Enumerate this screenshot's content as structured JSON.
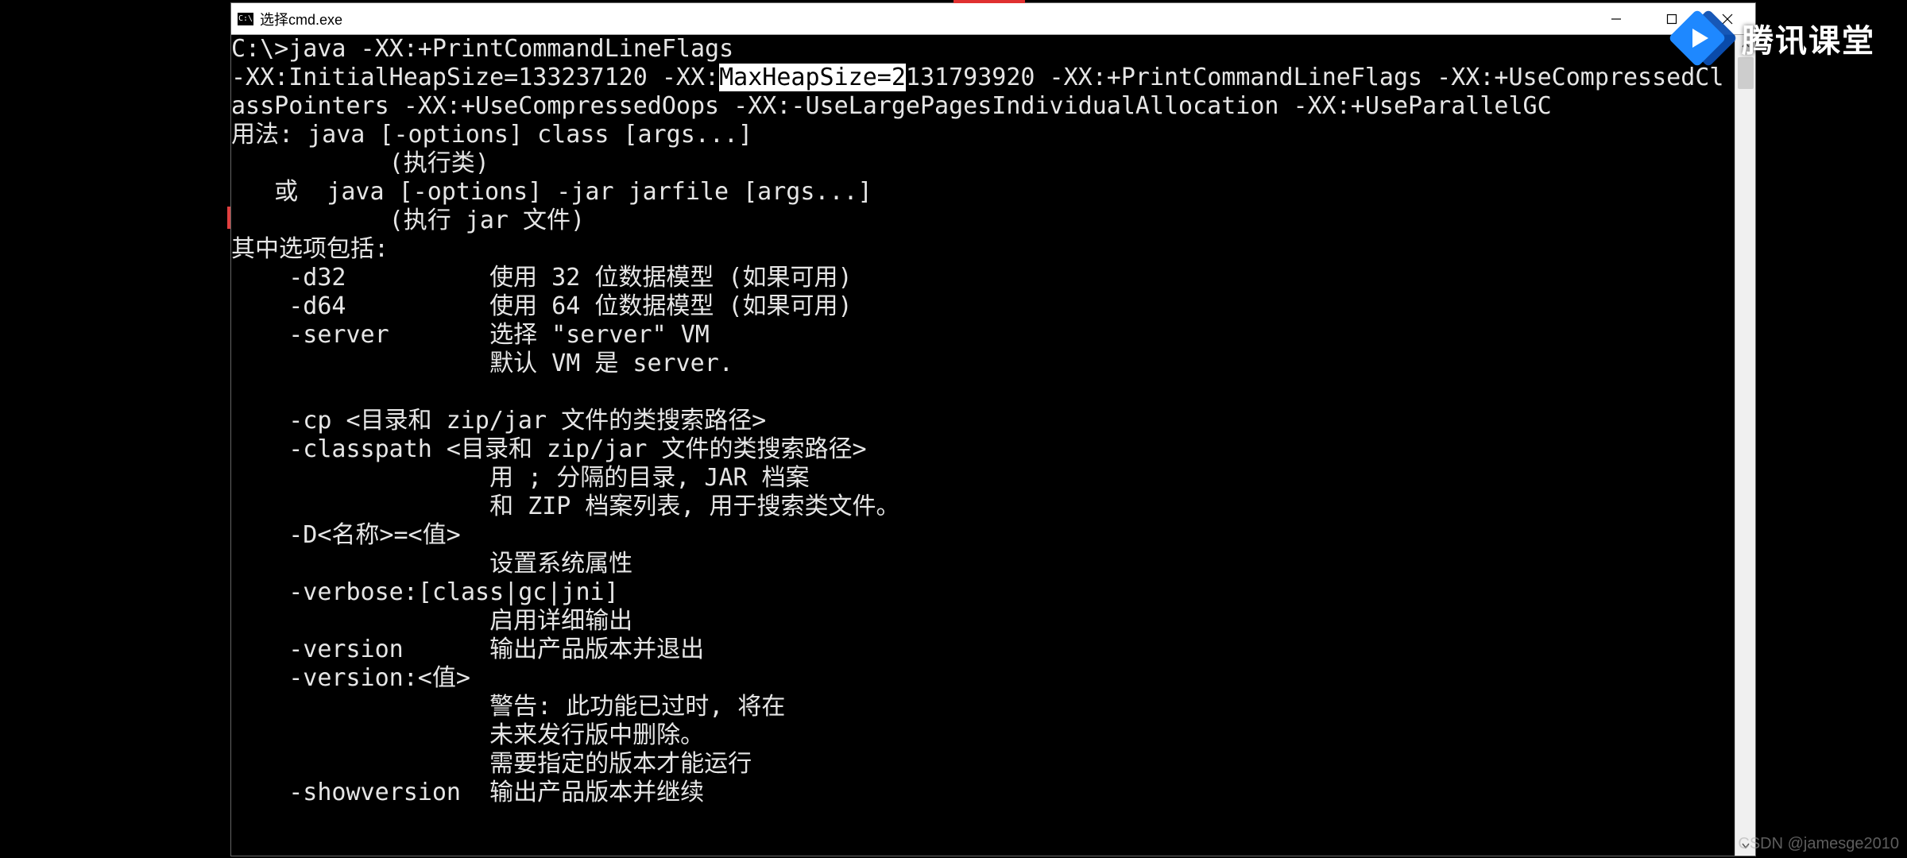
{
  "window": {
    "title": "选择cmd.exe",
    "icon_label": "C:\\"
  },
  "brand": {
    "text": "腾讯课堂"
  },
  "csdn": "CSDN @jamesge2010",
  "term": {
    "l01a": "C:\\>java -XX:+PrintCommandLineFlags",
    "l02a": "-XX:InitialHeapSize=133237120 -XX:",
    "l02sel": "MaxHeapSize=2",
    "l02b": "131793920 -XX:+PrintCommandLineFlags -XX:+UseCompressedCl",
    "l03": "assPointers -XX:+UseCompressedOops -XX:-UseLargePagesIndividualAllocation -XX:+UseParallelGC",
    "l04": "用法: java [-options] class [args...]",
    "l05": "           (执行类)",
    "l06": "   或  java [-options] -jar jarfile [args...]",
    "l07": "           (执行 jar 文件)",
    "l08": "其中选项包括:",
    "l09": "    -d32          使用 32 位数据模型 (如果可用)",
    "l10": "    -d64          使用 64 位数据模型 (如果可用)",
    "l11": "    -server       选择 \"server\" VM",
    "l12": "                  默认 VM 是 server.",
    "l13": "",
    "l14": "    -cp <目录和 zip/jar 文件的类搜索路径>",
    "l15": "    -classpath <目录和 zip/jar 文件的类搜索路径>",
    "l16": "                  用 ; 分隔的目录, JAR 档案",
    "l17": "                  和 ZIP 档案列表, 用于搜索类文件。",
    "l18": "    -D<名称>=<值>",
    "l19": "                  设置系统属性",
    "l20": "    -verbose:[class|gc|jni]",
    "l21": "                  启用详细输出",
    "l22": "    -version      输出产品版本并退出",
    "l23": "    -version:<值>",
    "l24": "                  警告: 此功能已过时, 将在",
    "l25": "                  未来发行版中删除。",
    "l26": "                  需要指定的版本才能运行",
    "l27": "    -showversion  输出产品版本并继续"
  }
}
